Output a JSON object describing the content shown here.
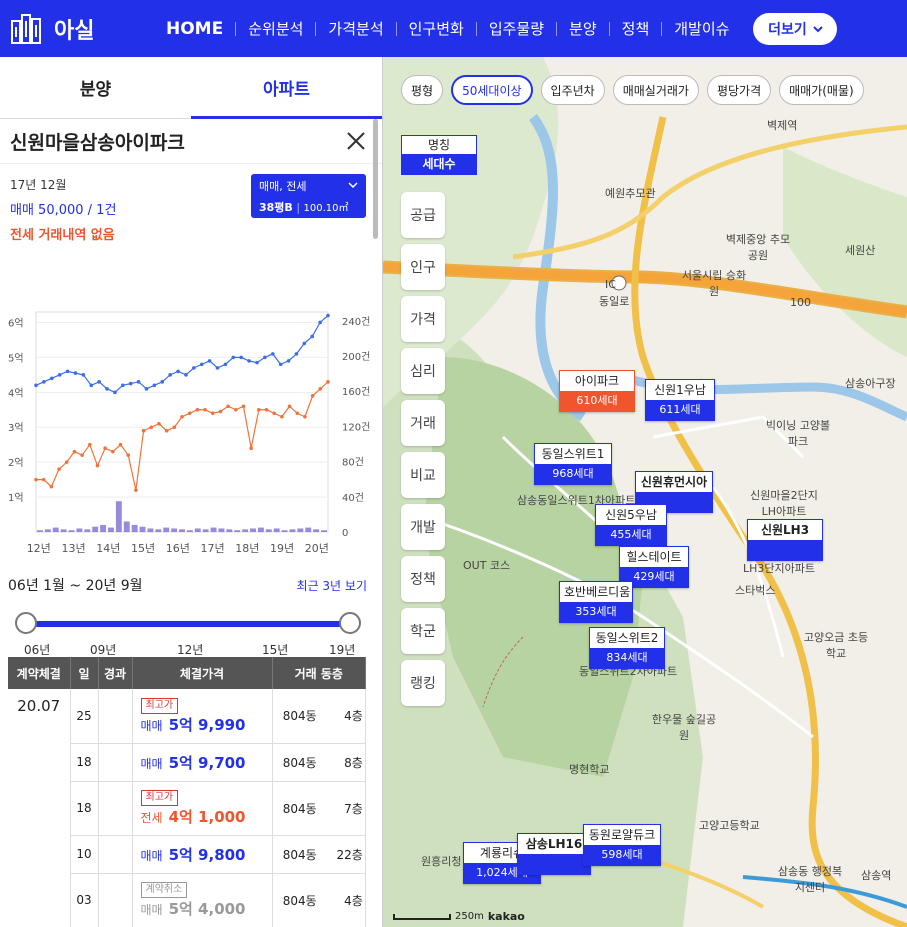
{
  "header": {
    "logo_text": "아실",
    "nav": [
      "HOME",
      "순위분석",
      "가격분석",
      "인구변화",
      "입주물량",
      "분양",
      "정책",
      "개발이슈"
    ],
    "more_label": "더보기"
  },
  "left": {
    "tabs": [
      "분양",
      "아파트"
    ],
    "active_tab": "아파트",
    "title": "신원마을삼송아이파크",
    "info_line1": "17년 12월",
    "info_line2": "매매 50,000 / 1건",
    "info_line3": "전세 거래내역 없음",
    "type_box": {
      "line1": "매매, 전세",
      "line2a": "38평B",
      "line2b": "100.10㎡"
    },
    "range_label": "06년 1월 ~ 20년 9월",
    "recent_link": "최근 3년 보기",
    "slider_ticks": [
      "06년",
      "09년",
      "12년",
      "15년",
      "19년"
    ],
    "table": {
      "headers": [
        "계약체결",
        "일",
        "경과",
        "체결가격",
        "거래 동층"
      ],
      "month": "20.07",
      "rows": [
        {
          "day": "25",
          "tag": "최고가",
          "tag_color": "red",
          "type": "매매",
          "price": "5억 9,990",
          "dong": "804동",
          "floor": "4층",
          "style": "b"
        },
        {
          "day": "18",
          "tag": "",
          "tag_color": "",
          "type": "매매",
          "price": "5억 9,700",
          "dong": "804동",
          "floor": "8층",
          "style": "b"
        },
        {
          "day": "18",
          "tag": "최고가",
          "tag_color": "red",
          "type": "전세",
          "price": "4억 1,000",
          "dong": "804동",
          "floor": "7층",
          "style": "r"
        },
        {
          "day": "10",
          "tag": "",
          "tag_color": "",
          "type": "매매",
          "price": "5억 9,800",
          "dong": "804동",
          "floor": "22층",
          "style": "b"
        },
        {
          "day": "03",
          "tag": "계약취소",
          "tag_color": "gray",
          "type": "매매",
          "price": "5억 4,000",
          "dong": "804동",
          "floor": "4층",
          "style": "g"
        }
      ]
    }
  },
  "chart_data": {
    "type": "line",
    "x": [
      "12년",
      "13년",
      "14년",
      "15년",
      "16년",
      "17년",
      "18년",
      "19년",
      "20년"
    ],
    "y_left_ticks": [
      "1억",
      "2억",
      "3억",
      "4억",
      "5억",
      "6억"
    ],
    "y_right_ticks": [
      "0",
      "40건",
      "80건",
      "120건",
      "160건",
      "200건",
      "240건"
    ],
    "ylim_left": [
      0,
      6.3
    ],
    "ylim_right": [
      0,
      250
    ],
    "series": [
      {
        "color": "#3b6ee8",
        "values": [
          4.2,
          4.3,
          4.4,
          4.5,
          4.6,
          4.55,
          4.5,
          4.2,
          4.3,
          4.1,
          4.0,
          4.2,
          4.25,
          4.3,
          4.1,
          4.2,
          4.3,
          4.5,
          4.6,
          4.5,
          4.7,
          4.8,
          4.9,
          4.7,
          4.8,
          5.0,
          5.0,
          4.9,
          4.85,
          5.0,
          5.1,
          4.8,
          4.9,
          5.1,
          5.4,
          5.6,
          6.0,
          6.2
        ]
      },
      {
        "color": "#f0733c",
        "values": [
          1.5,
          1.5,
          1.3,
          1.8,
          2.0,
          2.3,
          2.2,
          2.5,
          1.9,
          2.4,
          2.3,
          2.5,
          2.2,
          1.2,
          2.9,
          3.0,
          3.1,
          2.9,
          3.0,
          3.3,
          3.4,
          3.5,
          3.5,
          3.4,
          3.45,
          3.6,
          3.5,
          3.6,
          2.4,
          3.5,
          3.5,
          3.4,
          3.3,
          3.6,
          3.4,
          3.3,
          3.9,
          4.1,
          4.3
        ]
      },
      {
        "color": "#6a5acd",
        "values": [
          2,
          3,
          5,
          3,
          2,
          4,
          3,
          6,
          8,
          5,
          35,
          12,
          8,
          6,
          4,
          3,
          5,
          4,
          3,
          2,
          4,
          3,
          5,
          4,
          3,
          2,
          3,
          4,
          5,
          3,
          4,
          2,
          3,
          4,
          5,
          3,
          2
        ]
      }
    ]
  },
  "map": {
    "filters": [
      "평형",
      "50세대이상",
      "입주년차",
      "매매실거래가",
      "평당가격",
      "매매가(매물)"
    ],
    "selected_filter": "50세대이상",
    "legend": {
      "top": "명칭",
      "bottom": "세대수"
    },
    "side_menu": [
      "공급",
      "인구",
      "가격",
      "심리",
      "거래",
      "비교",
      "개발",
      "정책",
      "학군",
      "랭킹"
    ],
    "markers": [
      {
        "name": "아이파크",
        "count": "610세대",
        "red": true
      },
      {
        "name": "신원1우남",
        "count": "611세대",
        "red": false
      },
      {
        "name": "동일스위트1",
        "count": "968세대",
        "red": false
      },
      {
        "name": "신원휴먼시아",
        "count": "",
        "red": false
      },
      {
        "name": "신원5우남",
        "count": "455세대",
        "red": false
      },
      {
        "name": "신원LH3",
        "count": "",
        "red": false
      },
      {
        "name": "힐스테이트",
        "count": "429세대",
        "red": false
      },
      {
        "name": "호반베르디움",
        "count": "353세대",
        "red": false
      },
      {
        "name": "동일스위트2",
        "count": "834세대",
        "red": false
      },
      {
        "name": "계룡리슈",
        "count": "1,024세대",
        "red": false
      },
      {
        "name": "삼송LH16",
        "count": "",
        "red": false
      },
      {
        "name": "동원로얄듀크",
        "count": "598세대",
        "red": false
      }
    ],
    "labels": [
      "예원추모관",
      "벽제중앙 추모공원",
      "서울시립 승화원",
      "세원산",
      "삼송아구장",
      "빅이닝 고양볼파크",
      "신원마을2단지 LH아파트",
      "스타벅스",
      "고양오금 초등학교",
      "한우물 숲길공원",
      "명현학교",
      "고양고등학교",
      "삼송동 행정복지센터",
      "원흥리청",
      "OUT 코스",
      "삼송동일스위트1차아파트",
      "동일스위트2차아파트",
      "LH3단지아파트",
      "IC",
      "동일로",
      "100",
      "벽제역",
      "삼송역"
    ],
    "scale_label": "250m",
    "brand": "kakao"
  }
}
